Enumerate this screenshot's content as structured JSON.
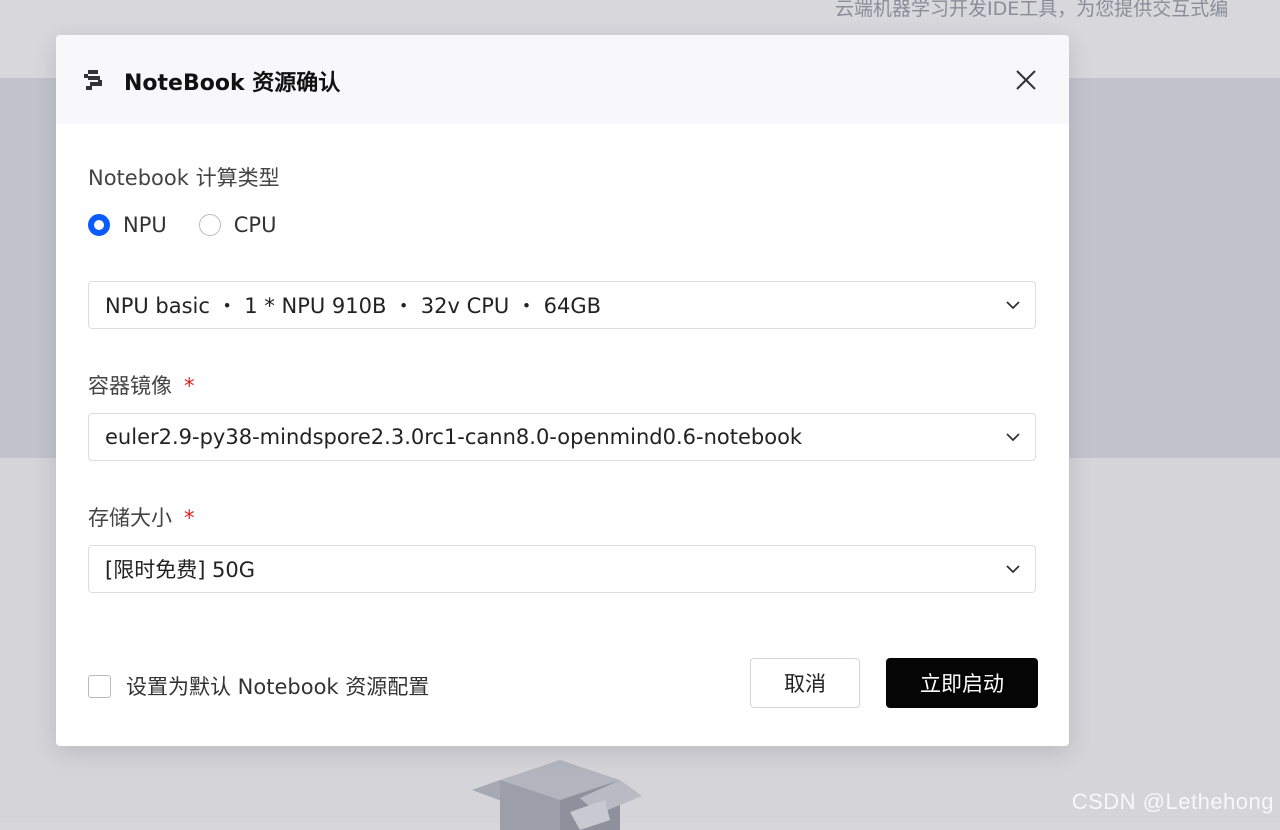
{
  "background": {
    "subtitle": "云端机器学习开发IDE工具，为您提供交互式编"
  },
  "watermark": "CSDN @Lethehong",
  "modal": {
    "title": "NoteBook 资源确认",
    "close_icon": "close-icon",
    "compute_type": {
      "label": "Notebook 计算类型",
      "options": [
        {
          "label": "NPU",
          "selected": true
        },
        {
          "label": "CPU",
          "selected": false
        }
      ]
    },
    "spec_select": {
      "value": "NPU basic ・ 1 * NPU 910B ・ 32v CPU ・ 64GB"
    },
    "image": {
      "label": "容器镜像",
      "required_mark": "*",
      "value": "euler2.9-py38-mindspore2.3.0rc1-cann8.0-openmind0.6-notebook"
    },
    "storage": {
      "label": "存储大小",
      "required_mark": "*",
      "value": "[限时免费] 50G"
    },
    "default_checkbox": {
      "label": "设置为默认 Notebook 资源配置",
      "checked": false
    },
    "buttons": {
      "cancel": "取消",
      "start": "立即启动"
    }
  },
  "colors": {
    "accent": "#0a5cff",
    "primary_button": "#050505",
    "required": "#e02020"
  }
}
